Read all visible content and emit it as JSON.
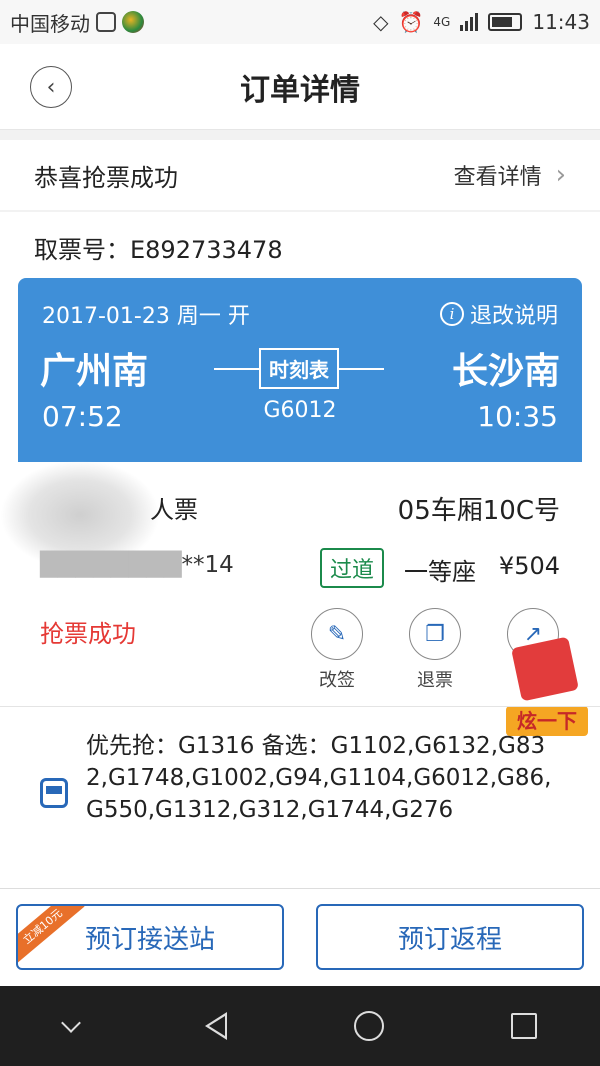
{
  "status_bar": {
    "carrier": "中国移动",
    "network": "4G",
    "time": "11:43"
  },
  "header": {
    "title": "订单详情"
  },
  "success_banner": {
    "text": "恭喜抢票成功",
    "detail_link": "查看详情"
  },
  "ticket": {
    "ticket_number_label": "取票号：",
    "ticket_number": "E892733478",
    "date_text": "2017-01-23 周一 开",
    "refund_info": "退改说明",
    "from_station": "广州南",
    "to_station": "长沙南",
    "schedule_button": "时刻表",
    "departure_time": "07:52",
    "arrival_time": "10:35",
    "train_number": "G6012"
  },
  "passenger": {
    "ticket_type": "人票",
    "id_masked": "**14",
    "coach_seat": "05车厢10C号",
    "status_badge": "过道",
    "seat_class": "一等座",
    "price": "¥504"
  },
  "order_status": "抢票成功",
  "actions": [
    {
      "label": "改签",
      "icon": "edit-icon"
    },
    {
      "label": "退票",
      "icon": "refund-icon"
    },
    {
      "label": "分享",
      "icon": "share-icon"
    }
  ],
  "promo": {
    "label": "炫一下"
  },
  "alternatives": {
    "text": "优先抢：G1316 备选：G1102,G6132,G832,G1748,G1002,G94,G1104,G6012,G86,G550,G1312,G312,G1744,G276"
  },
  "bottom_buttons": {
    "left": "预订接送站",
    "left_tag": "立减10元",
    "right": "预订返程"
  },
  "colors": {
    "card_blue": "#3f8fd8",
    "accent_blue": "#2868b8",
    "success_red": "#e53935",
    "badge_green": "#1b8a4b"
  }
}
